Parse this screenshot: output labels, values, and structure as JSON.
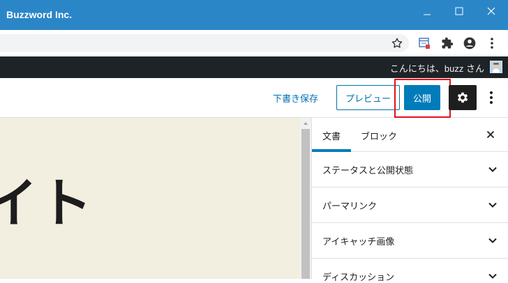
{
  "window": {
    "title": "Buzzword Inc."
  },
  "admin_bar": {
    "greeting": "こんにちは、buzz さん"
  },
  "editor": {
    "save_draft": "下書き保存",
    "preview": "プレビュー",
    "publish": "公開",
    "canvas_text": "イト"
  },
  "sidebar": {
    "tabs": [
      "文書",
      "ブロック"
    ],
    "panels": [
      "ステータスと公開状態",
      "パーマリンク",
      "アイキャッチ画像",
      "ディスカッション"
    ]
  },
  "colors": {
    "titlebar": "#2b86c8",
    "adminbar": "#1d2327",
    "accent": "#007cba",
    "highlight": "#e0121a",
    "canvas_bg": "#f3efe0"
  },
  "icons": [
    "minimize-icon",
    "maximize-icon",
    "close-icon",
    "bookmark-star-icon",
    "extension-tab-icon",
    "puzzle-icon",
    "profile-icon",
    "chrome-menu-icon",
    "gear-icon",
    "kebab-icon",
    "chevron-down-icon"
  ]
}
